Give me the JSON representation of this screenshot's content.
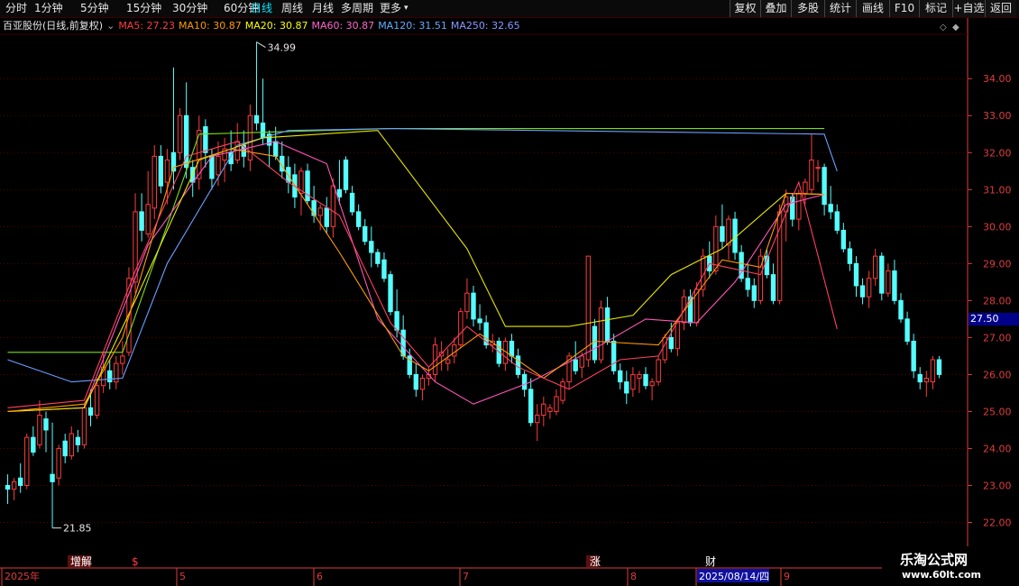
{
  "toolbar": {
    "timeframes": [
      "分时",
      "1分钟",
      "5分钟",
      "15分钟",
      "30分钟",
      "60分钟",
      "日线",
      "周线",
      "月线",
      "多周期",
      "更多"
    ],
    "active": "日线",
    "right_buttons": [
      "复权",
      "叠加",
      "多股",
      "统计",
      "画线",
      "F10",
      "标记",
      "+自选",
      "返回"
    ]
  },
  "legend": {
    "stock": "百亚股份(日线,前复权)",
    "ma": [
      {
        "label": "MA5: 27.23",
        "color": "#ff3c3c"
      },
      {
        "label": "MA10: 30.87",
        "color": "#ff9900"
      },
      {
        "label": "MA20: 30.87",
        "color": "#ffff00"
      },
      {
        "label": "MA60: 30.87",
        "color": "#ff66cc"
      },
      {
        "label": "MA120: 31.51",
        "color": "#66aaff"
      },
      {
        "label": "MA250: 32.65",
        "color": "#8899ff"
      }
    ]
  },
  "price_axis": [
    "34.00",
    "33.00",
    "32.00",
    "31.00",
    "30.00",
    "29.00",
    "28.00",
    "27.00",
    "26.00",
    "25.00",
    "24.00",
    "23.00",
    "22.00"
  ],
  "last_price": "27.50",
  "annotations": {
    "high": "34.99",
    "low": "21.85"
  },
  "events": [
    "增解",
    "$",
    "涨",
    "财"
  ],
  "date_axis": [
    "2025年",
    "5",
    "6",
    "7",
    "8",
    "2025/08/14/四",
    "9"
  ],
  "brand": {
    "name": "乐淘公式网",
    "url": "www.60lt.com"
  },
  "colors": {
    "up": "#ff3c3c",
    "down": "#54ffff",
    "grid": "#5a0000",
    "axis": "#e03c3c"
  },
  "chart_data": {
    "type": "candlestick",
    "ylim": [
      21.5,
      35.2
    ],
    "candles": [
      {
        "o": 23.0,
        "h": 23.3,
        "l": 22.5,
        "c": 22.9
      },
      {
        "o": 22.9,
        "h": 23.2,
        "l": 22.6,
        "c": 23.1
      },
      {
        "o": 23.2,
        "h": 23.6,
        "l": 22.8,
        "c": 23.0
      },
      {
        "o": 23.0,
        "h": 24.4,
        "l": 22.9,
        "c": 24.3
      },
      {
        "o": 24.3,
        "h": 24.6,
        "l": 23.8,
        "c": 23.9
      },
      {
        "o": 24.1,
        "h": 25.3,
        "l": 24.0,
        "c": 24.9
      },
      {
        "o": 24.8,
        "h": 25.0,
        "l": 23.9,
        "c": 24.5
      },
      {
        "o": 23.3,
        "h": 24.7,
        "l": 21.85,
        "c": 23.1
      },
      {
        "o": 23.2,
        "h": 24.1,
        "l": 23.0,
        "c": 24.0
      },
      {
        "o": 24.2,
        "h": 24.4,
        "l": 23.6,
        "c": 23.8
      },
      {
        "o": 23.8,
        "h": 24.6,
        "l": 23.7,
        "c": 24.4
      },
      {
        "o": 24.3,
        "h": 24.5,
        "l": 23.9,
        "c": 24.1
      },
      {
        "o": 24.1,
        "h": 25.2,
        "l": 24.0,
        "c": 25.1
      },
      {
        "o": 25.1,
        "h": 25.6,
        "l": 24.6,
        "c": 24.9
      },
      {
        "o": 24.9,
        "h": 25.9,
        "l": 24.8,
        "c": 25.7
      },
      {
        "o": 25.7,
        "h": 26.6,
        "l": 25.5,
        "c": 26.2
      },
      {
        "o": 26.1,
        "h": 26.4,
        "l": 25.6,
        "c": 25.8
      },
      {
        "o": 25.8,
        "h": 26.5,
        "l": 25.6,
        "c": 26.3
      },
      {
        "o": 26.3,
        "h": 26.9,
        "l": 26.0,
        "c": 26.5
      },
      {
        "o": 26.6,
        "h": 28.9,
        "l": 26.5,
        "c": 28.6
      },
      {
        "o": 28.5,
        "h": 30.9,
        "l": 28.2,
        "c": 30.4
      },
      {
        "o": 30.4,
        "h": 30.9,
        "l": 29.6,
        "c": 29.9
      },
      {
        "o": 29.8,
        "h": 31.5,
        "l": 29.7,
        "c": 30.6
      },
      {
        "o": 30.5,
        "h": 32.2,
        "l": 30.2,
        "c": 31.9
      },
      {
        "o": 31.9,
        "h": 32.2,
        "l": 30.9,
        "c": 31.1
      },
      {
        "o": 31.2,
        "h": 32.1,
        "l": 30.6,
        "c": 31.8
      },
      {
        "o": 32.0,
        "h": 34.3,
        "l": 31.0,
        "c": 31.5
      },
      {
        "o": 32.0,
        "h": 33.2,
        "l": 31.8,
        "c": 33.0
      },
      {
        "o": 33.0,
        "h": 33.9,
        "l": 31.3,
        "c": 31.6
      },
      {
        "o": 31.6,
        "h": 31.8,
        "l": 30.8,
        "c": 31.2
      },
      {
        "o": 31.3,
        "h": 33.0,
        "l": 31.0,
        "c": 32.6
      },
      {
        "o": 32.7,
        "h": 32.9,
        "l": 31.6,
        "c": 32.0
      },
      {
        "o": 31.9,
        "h": 32.1,
        "l": 31.0,
        "c": 31.3
      },
      {
        "o": 31.4,
        "h": 32.3,
        "l": 31.1,
        "c": 31.9
      },
      {
        "o": 31.8,
        "h": 32.4,
        "l": 31.2,
        "c": 32.1
      },
      {
        "o": 32.0,
        "h": 32.6,
        "l": 31.5,
        "c": 31.7
      },
      {
        "o": 31.8,
        "h": 32.8,
        "l": 31.7,
        "c": 32.3
      },
      {
        "o": 32.2,
        "h": 32.6,
        "l": 31.6,
        "c": 31.9
      },
      {
        "o": 31.8,
        "h": 33.3,
        "l": 31.5,
        "c": 33.0
      },
      {
        "o": 33.0,
        "h": 34.99,
        "l": 32.6,
        "c": 32.8
      },
      {
        "o": 32.8,
        "h": 34.0,
        "l": 32.2,
        "c": 32.4
      },
      {
        "o": 32.5,
        "h": 32.6,
        "l": 31.6,
        "c": 32.2
      },
      {
        "o": 32.3,
        "h": 32.7,
        "l": 31.8,
        "c": 31.9
      },
      {
        "o": 31.9,
        "h": 32.3,
        "l": 31.3,
        "c": 31.5
      },
      {
        "o": 31.6,
        "h": 31.9,
        "l": 30.9,
        "c": 31.2
      },
      {
        "o": 31.4,
        "h": 31.7,
        "l": 30.5,
        "c": 30.8
      },
      {
        "o": 30.9,
        "h": 31.6,
        "l": 30.3,
        "c": 31.5
      },
      {
        "o": 31.5,
        "h": 31.7,
        "l": 30.6,
        "c": 30.7
      },
      {
        "o": 30.7,
        "h": 31.1,
        "l": 30.1,
        "c": 30.3
      },
      {
        "o": 30.3,
        "h": 30.6,
        "l": 29.9,
        "c": 30.5
      },
      {
        "o": 30.5,
        "h": 30.8,
        "l": 29.8,
        "c": 30.0
      },
      {
        "o": 30.0,
        "h": 31.3,
        "l": 29.7,
        "c": 31.1
      },
      {
        "o": 31.0,
        "h": 31.8,
        "l": 30.6,
        "c": 30.8
      },
      {
        "o": 31.8,
        "h": 31.9,
        "l": 30.9,
        "c": 31.0
      },
      {
        "o": 30.9,
        "h": 31.1,
        "l": 30.3,
        "c": 30.4
      },
      {
        "o": 30.4,
        "h": 30.6,
        "l": 29.9,
        "c": 30.0
      },
      {
        "o": 30.0,
        "h": 30.2,
        "l": 29.5,
        "c": 29.6
      },
      {
        "o": 29.6,
        "h": 30.0,
        "l": 28.9,
        "c": 29.3
      },
      {
        "o": 29.3,
        "h": 29.4,
        "l": 28.9,
        "c": 29.0
      },
      {
        "o": 29.1,
        "h": 29.3,
        "l": 28.5,
        "c": 28.6
      },
      {
        "o": 28.7,
        "h": 28.8,
        "l": 27.6,
        "c": 27.7
      },
      {
        "o": 27.7,
        "h": 28.3,
        "l": 27.0,
        "c": 27.2
      },
      {
        "o": 27.2,
        "h": 27.6,
        "l": 26.4,
        "c": 26.5
      },
      {
        "o": 26.5,
        "h": 26.7,
        "l": 25.9,
        "c": 26.0
      },
      {
        "o": 26.0,
        "h": 26.3,
        "l": 25.4,
        "c": 25.6
      },
      {
        "o": 25.6,
        "h": 26.0,
        "l": 25.3,
        "c": 25.9
      },
      {
        "o": 25.9,
        "h": 26.2,
        "l": 25.7,
        "c": 26.0
      },
      {
        "o": 26.0,
        "h": 27.0,
        "l": 25.8,
        "c": 26.8
      },
      {
        "o": 26.5,
        "h": 26.9,
        "l": 26.1,
        "c": 26.6
      },
      {
        "o": 26.3,
        "h": 26.7,
        "l": 26.1,
        "c": 26.4
      },
      {
        "o": 26.5,
        "h": 27.0,
        "l": 26.3,
        "c": 26.8
      },
      {
        "o": 26.8,
        "h": 27.8,
        "l": 26.7,
        "c": 27.7
      },
      {
        "o": 27.7,
        "h": 28.6,
        "l": 27.5,
        "c": 28.2
      },
      {
        "o": 28.2,
        "h": 28.4,
        "l": 27.3,
        "c": 27.5
      },
      {
        "o": 27.5,
        "h": 27.9,
        "l": 27.2,
        "c": 27.4
      },
      {
        "o": 27.4,
        "h": 27.6,
        "l": 26.7,
        "c": 26.8
      },
      {
        "o": 26.8,
        "h": 27.1,
        "l": 26.6,
        "c": 26.9
      },
      {
        "o": 26.9,
        "h": 27.0,
        "l": 26.2,
        "c": 26.3
      },
      {
        "o": 26.3,
        "h": 27.0,
        "l": 26.1,
        "c": 26.9
      },
      {
        "o": 26.9,
        "h": 27.1,
        "l": 26.3,
        "c": 26.5
      },
      {
        "o": 26.5,
        "h": 26.7,
        "l": 25.9,
        "c": 26.0
      },
      {
        "o": 26.0,
        "h": 26.1,
        "l": 25.4,
        "c": 25.6
      },
      {
        "o": 25.6,
        "h": 25.9,
        "l": 24.6,
        "c": 24.7
      },
      {
        "o": 24.7,
        "h": 25.2,
        "l": 24.2,
        "c": 24.9
      },
      {
        "o": 24.9,
        "h": 25.4,
        "l": 24.6,
        "c": 25.2
      },
      {
        "o": 25.0,
        "h": 25.2,
        "l": 24.8,
        "c": 25.1
      },
      {
        "o": 25.0,
        "h": 25.6,
        "l": 24.9,
        "c": 25.4
      },
      {
        "o": 25.3,
        "h": 25.9,
        "l": 25.2,
        "c": 25.8
      },
      {
        "o": 25.8,
        "h": 26.6,
        "l": 25.6,
        "c": 26.5
      },
      {
        "o": 26.4,
        "h": 26.9,
        "l": 26.0,
        "c": 26.1
      },
      {
        "o": 26.2,
        "h": 26.6,
        "l": 25.9,
        "c": 26.5
      },
      {
        "o": 26.4,
        "h": 29.2,
        "l": 26.2,
        "c": 29.2
      },
      {
        "o": 27.3,
        "h": 27.5,
        "l": 26.3,
        "c": 26.4
      },
      {
        "o": 26.4,
        "h": 28.0,
        "l": 26.3,
        "c": 27.8
      },
      {
        "o": 27.8,
        "h": 28.1,
        "l": 26.8,
        "c": 26.9
      },
      {
        "o": 26.9,
        "h": 27.1,
        "l": 26.0,
        "c": 26.1
      },
      {
        "o": 26.1,
        "h": 26.3,
        "l": 25.6,
        "c": 25.8
      },
      {
        "o": 25.8,
        "h": 26.1,
        "l": 25.2,
        "c": 25.5
      },
      {
        "o": 25.6,
        "h": 26.2,
        "l": 25.4,
        "c": 26.0
      },
      {
        "o": 25.9,
        "h": 26.1,
        "l": 25.5,
        "c": 26.0
      },
      {
        "o": 26.0,
        "h": 26.2,
        "l": 25.6,
        "c": 25.7
      },
      {
        "o": 25.7,
        "h": 25.9,
        "l": 25.3,
        "c": 25.8
      },
      {
        "o": 25.8,
        "h": 26.5,
        "l": 25.7,
        "c": 26.4
      },
      {
        "o": 26.4,
        "h": 27.1,
        "l": 26.3,
        "c": 27.0
      },
      {
        "o": 27.0,
        "h": 27.4,
        "l": 26.6,
        "c": 26.7
      },
      {
        "o": 26.7,
        "h": 27.5,
        "l": 26.5,
        "c": 27.4
      },
      {
        "o": 27.4,
        "h": 28.3,
        "l": 27.2,
        "c": 28.1
      },
      {
        "o": 28.1,
        "h": 28.3,
        "l": 27.3,
        "c": 27.4
      },
      {
        "o": 27.4,
        "h": 28.5,
        "l": 27.3,
        "c": 28.3
      },
      {
        "o": 28.3,
        "h": 29.4,
        "l": 28.1,
        "c": 29.2
      },
      {
        "o": 29.2,
        "h": 29.6,
        "l": 28.6,
        "c": 28.8
      },
      {
        "o": 28.8,
        "h": 30.3,
        "l": 28.7,
        "c": 30.0
      },
      {
        "o": 30.0,
        "h": 30.6,
        "l": 29.4,
        "c": 29.6
      },
      {
        "o": 29.5,
        "h": 30.3,
        "l": 29.1,
        "c": 30.2
      },
      {
        "o": 30.2,
        "h": 30.4,
        "l": 29.1,
        "c": 29.3
      },
      {
        "o": 29.3,
        "h": 29.5,
        "l": 28.5,
        "c": 28.6
      },
      {
        "o": 28.6,
        "h": 29.0,
        "l": 28.1,
        "c": 28.3
      },
      {
        "o": 28.4,
        "h": 28.6,
        "l": 27.8,
        "c": 28.0
      },
      {
        "o": 28.0,
        "h": 29.4,
        "l": 27.9,
        "c": 29.2
      },
      {
        "o": 29.2,
        "h": 29.4,
        "l": 28.6,
        "c": 28.7
      },
      {
        "o": 28.7,
        "h": 29.0,
        "l": 27.9,
        "c": 28.0
      },
      {
        "o": 28.0,
        "h": 30.6,
        "l": 27.9,
        "c": 30.4
      },
      {
        "o": 30.4,
        "h": 31.0,
        "l": 29.6,
        "c": 30.8
      },
      {
        "o": 30.8,
        "h": 30.9,
        "l": 30.0,
        "c": 30.2
      },
      {
        "o": 30.2,
        "h": 31.0,
        "l": 29.9,
        "c": 30.9
      },
      {
        "o": 30.9,
        "h": 31.3,
        "l": 30.6,
        "c": 31.2
      },
      {
        "o": 31.0,
        "h": 32.5,
        "l": 30.9,
        "c": 31.8
      },
      {
        "o": 31.6,
        "h": 31.8,
        "l": 31.2,
        "c": 31.6
      },
      {
        "o": 31.6,
        "h": 31.7,
        "l": 30.3,
        "c": 30.6
      },
      {
        "o": 30.6,
        "h": 31.1,
        "l": 30.2,
        "c": 30.4
      },
      {
        "o": 30.4,
        "h": 30.6,
        "l": 29.8,
        "c": 29.9
      },
      {
        "o": 29.9,
        "h": 30.1,
        "l": 29.3,
        "c": 29.4
      },
      {
        "o": 29.4,
        "h": 29.6,
        "l": 28.8,
        "c": 29.0
      },
      {
        "o": 29.0,
        "h": 29.2,
        "l": 28.1,
        "c": 28.4
      },
      {
        "o": 28.4,
        "h": 28.6,
        "l": 27.9,
        "c": 28.1
      },
      {
        "o": 28.1,
        "h": 28.8,
        "l": 27.8,
        "c": 28.6
      },
      {
        "o": 28.6,
        "h": 29.4,
        "l": 28.4,
        "c": 29.2
      },
      {
        "o": 29.2,
        "h": 29.3,
        "l": 28.0,
        "c": 28.2
      },
      {
        "o": 28.2,
        "h": 29.0,
        "l": 28.1,
        "c": 28.8
      },
      {
        "o": 28.8,
        "h": 29.1,
        "l": 27.9,
        "c": 28.0
      },
      {
        "o": 28.0,
        "h": 28.2,
        "l": 27.4,
        "c": 27.5
      },
      {
        "o": 27.5,
        "h": 27.7,
        "l": 26.8,
        "c": 26.9
      },
      {
        "o": 26.9,
        "h": 27.1,
        "l": 25.9,
        "c": 26.1
      },
      {
        "o": 26.0,
        "h": 26.2,
        "l": 25.6,
        "c": 25.8
      },
      {
        "o": 25.8,
        "h": 26.1,
        "l": 25.4,
        "c": 25.9
      },
      {
        "o": 25.8,
        "h": 26.5,
        "l": 25.6,
        "c": 26.4
      },
      {
        "o": 26.4,
        "h": 26.5,
        "l": 25.9,
        "c": 26.0
      }
    ],
    "ma_lines": {
      "MA250": [
        [
          0,
          26.6
        ],
        [
          18,
          26.6
        ],
        [
          30,
          32.5
        ],
        [
          60,
          32.65
        ],
        [
          128,
          32.65
        ]
      ],
      "MA120": [
        [
          0,
          26.4
        ],
        [
          10,
          25.8
        ],
        [
          18,
          25.9
        ],
        [
          25,
          29.0
        ],
        [
          36,
          32.2
        ],
        [
          44,
          32.6
        ],
        [
          60,
          32.65
        ],
        [
          128,
          32.5
        ],
        [
          130,
          31.5
        ]
      ],
      "MA60": [
        [
          0,
          25.0
        ],
        [
          12,
          25.1
        ],
        [
          22,
          29.5
        ],
        [
          32,
          31.9
        ],
        [
          42,
          32.3
        ],
        [
          50,
          31.7
        ],
        [
          58,
          27.5
        ],
        [
          67,
          25.8
        ],
        [
          73,
          25.2
        ],
        [
          82,
          25.8
        ],
        [
          92,
          26.7
        ],
        [
          100,
          27.5
        ],
        [
          108,
          27.4
        ],
        [
          114,
          28.5
        ],
        [
          122,
          30.6
        ],
        [
          128,
          30.87
        ]
      ],
      "MA20": [
        [
          0,
          25.0
        ],
        [
          12,
          25.1
        ],
        [
          20,
          28.0
        ],
        [
          30,
          31.8
        ],
        [
          40,
          32.4
        ],
        [
          58,
          32.6
        ],
        [
          72,
          29.4
        ],
        [
          78,
          27.3
        ],
        [
          88,
          27.3
        ],
        [
          98,
          27.6
        ],
        [
          104,
          28.7
        ],
        [
          112,
          29.4
        ],
        [
          122,
          30.9
        ],
        [
          128,
          30.87
        ]
      ],
      "MA10": [
        [
          0,
          25.0
        ],
        [
          12,
          25.2
        ],
        [
          18,
          27.0
        ],
        [
          26,
          31.6
        ],
        [
          35,
          32.1
        ],
        [
          42,
          31.9
        ],
        [
          52,
          29.3
        ],
        [
          62,
          26.5
        ],
        [
          66,
          26.1
        ],
        [
          74,
          27.1
        ],
        [
          84,
          25.9
        ],
        [
          92,
          26.9
        ],
        [
          102,
          26.8
        ],
        [
          112,
          29.1
        ],
        [
          118,
          28.9
        ],
        [
          122,
          30.9
        ],
        [
          128,
          30.87
        ]
      ],
      "MA5": [
        [
          0,
          25.1
        ],
        [
          12,
          25.3
        ],
        [
          20,
          28.8
        ],
        [
          28,
          31.9
        ],
        [
          36,
          32.3
        ],
        [
          44,
          31.2
        ],
        [
          52,
          30.3
        ],
        [
          60,
          27.4
        ],
        [
          66,
          26.2
        ],
        [
          72,
          27.3
        ],
        [
          80,
          26.2
        ],
        [
          88,
          25.6
        ],
        [
          96,
          26.4
        ],
        [
          102,
          26.5
        ],
        [
          110,
          29.0
        ],
        [
          118,
          28.7
        ],
        [
          124,
          31.2
        ],
        [
          130,
          27.23
        ]
      ]
    }
  }
}
